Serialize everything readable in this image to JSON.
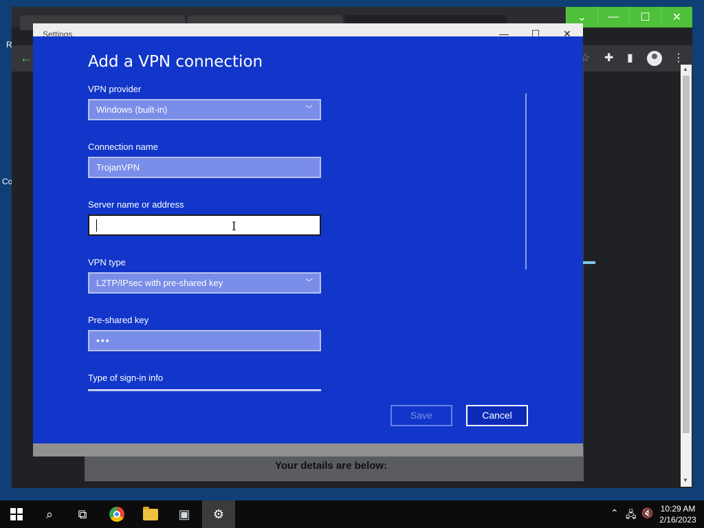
{
  "desktop": {
    "icon_labels": [
      "R",
      "Co"
    ]
  },
  "browser": {
    "content_heading": "Your details are below:"
  },
  "settings_window": {
    "title": "Settings",
    "minimize_glyph": "—",
    "maximize_glyph": "☐",
    "close_glyph": "✕"
  },
  "dialog": {
    "title": "Add a VPN connection",
    "vpn_provider": {
      "label": "VPN provider",
      "value": "Windows (built-in)"
    },
    "connection_name": {
      "label": "Connection name",
      "value": "TrojanVPN"
    },
    "server_address": {
      "label": "Server name or address",
      "value": ""
    },
    "vpn_type": {
      "label": "VPN type",
      "value": "L2TP/IPsec with pre-shared key"
    },
    "pre_shared_key": {
      "label": "Pre-shared key",
      "value": "•••"
    },
    "sign_in_type": {
      "label": "Type of sign-in info"
    },
    "save_label": "Save",
    "cancel_label": "Cancel"
  },
  "taskbar": {
    "time": "10:29 AM",
    "date": "2/16/2023"
  },
  "colors": {
    "dialog_bg": "#1136c9",
    "field_bg": "#7a8de8",
    "taskbar_bg": "#0c0c0c",
    "browser_accent": "#4ec03a"
  }
}
